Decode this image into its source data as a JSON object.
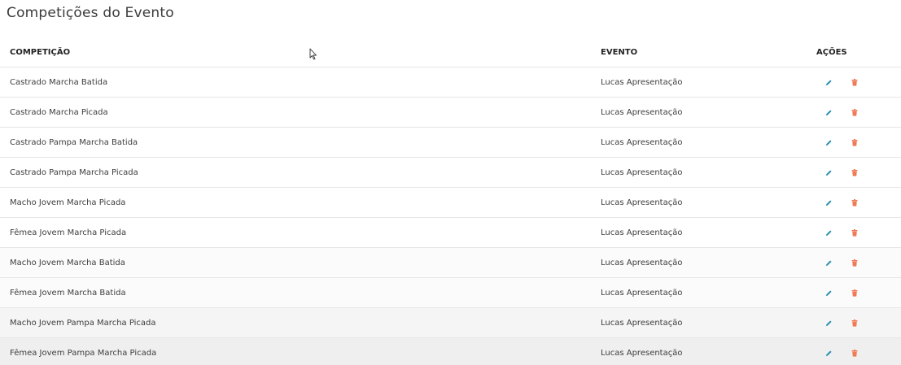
{
  "page": {
    "title": "Competições do Evento"
  },
  "table": {
    "headers": {
      "competition": "COMPETIÇÃO",
      "event": "EVENTO",
      "actions": "AÇÕES"
    },
    "rows": [
      {
        "competition": "Castrado Marcha Batida",
        "event": "Lucas Apresentação"
      },
      {
        "competition": "Castrado Marcha Picada",
        "event": "Lucas Apresentação"
      },
      {
        "competition": "Castrado Pampa Marcha Batida",
        "event": "Lucas Apresentação"
      },
      {
        "competition": "Castrado Pampa Marcha Picada",
        "event": "Lucas Apresentação"
      },
      {
        "competition": "Macho Jovem Marcha Picada",
        "event": "Lucas Apresentação"
      },
      {
        "competition": "Fêmea Jovem Marcha Picada",
        "event": "Lucas Apresentação"
      },
      {
        "competition": "Macho Jovem Marcha Batida",
        "event": "Lucas Apresentação"
      },
      {
        "competition": "Fêmea Jovem Marcha Batida",
        "event": "Lucas Apresentação"
      },
      {
        "competition": "Macho Jovem Pampa Marcha Picada",
        "event": "Lucas Apresentação"
      },
      {
        "competition": "Fêmea Jovem Pampa Marcha Picada",
        "event": "Lucas Apresentação"
      }
    ]
  },
  "icons": {
    "edit": "pencil-icon",
    "delete": "trash-icon"
  },
  "colors": {
    "edit": "#2a8fb0",
    "delete": "#f07a55",
    "text": "#3d3d3d",
    "divider": "#e6e6e6"
  }
}
